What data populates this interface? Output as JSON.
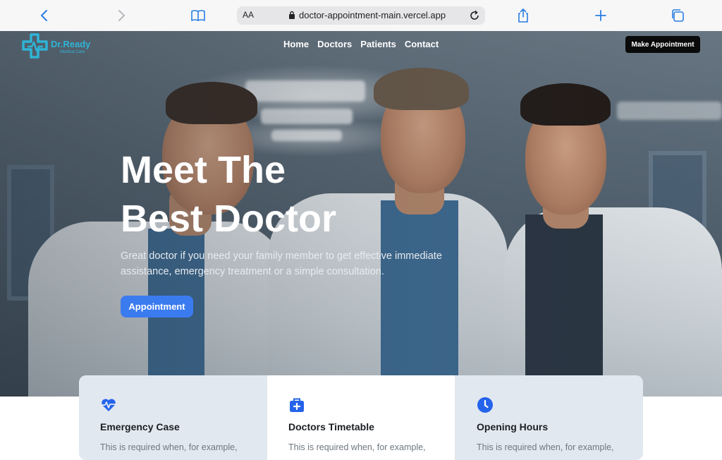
{
  "browser": {
    "text_size_label": "AA",
    "url": "doctor-appointment-main.vercel.app"
  },
  "brand": {
    "name": "Dr.Ready",
    "tagline": "Medical Care",
    "accent_color": "#2fb4d7"
  },
  "nav": {
    "items": [
      "Home",
      "Doctors",
      "Patients",
      "Contact"
    ],
    "cta_label": "Make Appointment"
  },
  "hero": {
    "title_line1": "Meet The",
    "title_line2": "Best Doctor",
    "subtitle": "Great doctor if you need your family member to get effective immediate assistance, emergency treatment or a simple consultation.",
    "button_label": "Appointment",
    "button_color": "#3b7bf0"
  },
  "cards": [
    {
      "icon": "heart-pulse-icon",
      "title": "Emergency Case",
      "text": "This is required when, for example,"
    },
    {
      "icon": "medical-kit-icon",
      "title": "Doctors Timetable",
      "text": "This is required when, for example,"
    },
    {
      "icon": "clock-icon",
      "title": "Opening Hours",
      "text": "This is required when, for example,"
    }
  ]
}
